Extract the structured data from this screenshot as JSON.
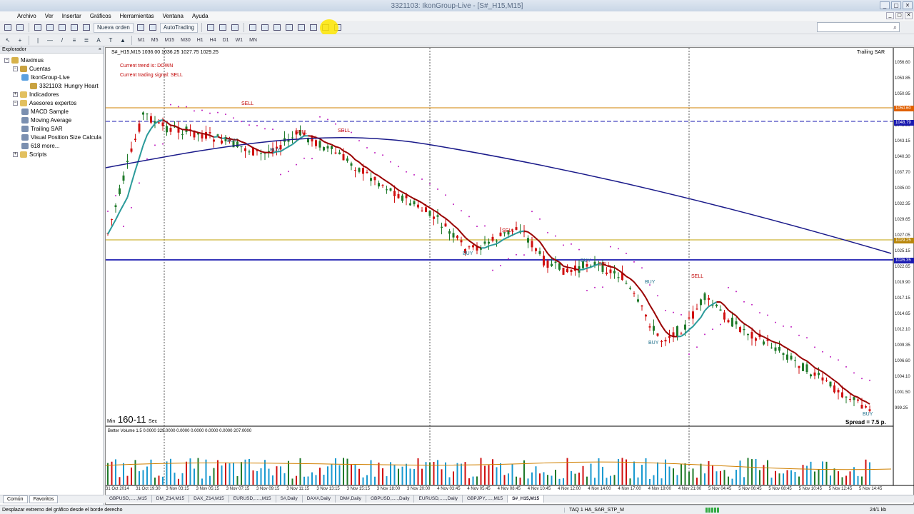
{
  "window": {
    "title": "3321103: IkonGroup-Live - [S#_H15,M15]",
    "buttons": [
      "_",
      "▢",
      "✕"
    ]
  },
  "menu": [
    "Archivo",
    "Ver",
    "Insertar",
    "Gráficos",
    "Herramientas",
    "Ventana",
    "Ayuda"
  ],
  "toolbar": {
    "new_order": "Nueva orden",
    "autotrading": "AutoTrading",
    "timeframes": [
      "M1",
      "M5",
      "M15",
      "M30",
      "H1",
      "H4",
      "D1",
      "W1",
      "MN"
    ],
    "highlight_color": "#ffe600"
  },
  "search": {
    "icon": "search-icon"
  },
  "explorer": {
    "title": "Explorador",
    "items": [
      {
        "label": "Maximus",
        "level": 0,
        "icon": "terminal-icon"
      },
      {
        "label": "Cuentas",
        "level": 1,
        "icon": "accounts-icon"
      },
      {
        "label": "IkonGroup-Live",
        "level": 2,
        "icon": "server-icon"
      },
      {
        "label": "3321103: Hungry Heart",
        "level": 3,
        "icon": "user-icon"
      },
      {
        "label": "Indicadores",
        "level": 1,
        "icon": "folder-icon"
      },
      {
        "label": "Asesores expertos",
        "level": 1,
        "icon": "folder-icon"
      },
      {
        "label": "MACD Sample",
        "level": 2,
        "icon": "expert-icon"
      },
      {
        "label": "Moving Average",
        "level": 2,
        "icon": "expert-icon"
      },
      {
        "label": "Trailing SAR",
        "level": 2,
        "icon": "expert-icon"
      },
      {
        "label": "Visual Position Size Calcula",
        "level": 2,
        "icon": "expert-icon"
      },
      {
        "label": "618 more...",
        "level": 2,
        "icon": "expert-icon"
      },
      {
        "label": "Scripts",
        "level": 1,
        "icon": "folder-icon"
      }
    ],
    "tabs": [
      "Común",
      "Favoritos"
    ]
  },
  "chart": {
    "header": "S#_H15,M15  1036.00 1036.25 1027.75 1029.25",
    "ea_label": "Trailing SAR",
    "trend_text": "Current trend is: DOWN",
    "signal_text": "Current trading signal: SELL",
    "timer": "160-11",
    "timer_prefix": "Min",
    "timer_suffix": "Sec",
    "spread": "Spread = 7.5 p.",
    "volume_header": "Better Volume 1.5  0.0000 329.0000 0.0000 0.0000 0.0000 0.0000 207.0000",
    "price_labels": [
      "1056.60",
      "1053.85",
      "1050.95",
      "1048.10",
      "1045.90",
      "1043.15",
      "1040.30",
      "1037.70",
      "1035.00",
      "1032.35",
      "1029.65",
      "1027.05",
      "1025.15",
      "1022.65",
      "1019.90",
      "1017.15",
      "1014.65",
      "1012.10",
      "1009.35",
      "1006.60",
      "1004.10",
      "1001.50",
      "999.25"
    ],
    "price_tags": [
      {
        "text": "1050.60",
        "color": "#e06000"
      },
      {
        "text": "1048.79",
        "color": "#1a1ab0"
      },
      {
        "text": "1029.25",
        "color": "#b8860b"
      },
      {
        "text": "1026.35",
        "color": "#1a1ab0"
      }
    ],
    "time_labels": [
      "31 Oct 2014",
      "31 Oct 19:30",
      "3 Nov 03:15",
      "3 Nov 05:15",
      "3 Nov 07:15",
      "3 Nov 09:15",
      "3 Nov 11:15",
      "3 Nov 13:15",
      "3 Nov 15:15",
      "3 Nov 18:00",
      "3 Nov 20:00",
      "4 Nov 03:45",
      "4 Nov 05:45",
      "4 Nov 08:45",
      "4 Nov 10:45",
      "4 Nov 12:00",
      "4 Nov 14:00",
      "4 Nov 17:00",
      "4 Nov 19:00",
      "4 Nov 21:00",
      "5 Nov 04:45",
      "5 Nov 06:45",
      "5 Nov 08:45",
      "5 Nov 10:45",
      "5 Nov 12:45",
      "5 Nov 14:45"
    ],
    "signals": [
      "SELL",
      "BUY",
      "SELL",
      "BUY",
      "SELL",
      "BUY",
      "SELL",
      "BUY",
      "SELL",
      "BUY",
      "SELL",
      "BUY",
      "BUY"
    ],
    "colors": {
      "bull": "#1f7a2a",
      "bear": "#d01010",
      "sar": "#c020c0",
      "ma_slow": "#1a1a8a",
      "ma_down": "#990000",
      "ma_up": "#2a9a9a",
      "hline_orange": "#d08000",
      "hline_blue": "#1a1ab0",
      "hline_gold": "#c0a000"
    }
  },
  "symbol_tabs": [
    "GBPUSD,.....,M15",
    "DM_Z14,M15",
    "DAX_Z14,M15",
    "EURUSD,.....,M15",
    "S#,Daily",
    "DAX#,Daily",
    "DM#,Daily",
    "GBPUSD,.....,Daily",
    "EURUSD,.....,Daily",
    "GBPJPY,.....,M15",
    "S#_H15,M15"
  ],
  "status": {
    "hint": "Desplazar extremo del gráfico desde el borde derecho",
    "profile": "TAQ 1 HA_SAR_STP_M",
    "traffic": "24/1 kb"
  }
}
